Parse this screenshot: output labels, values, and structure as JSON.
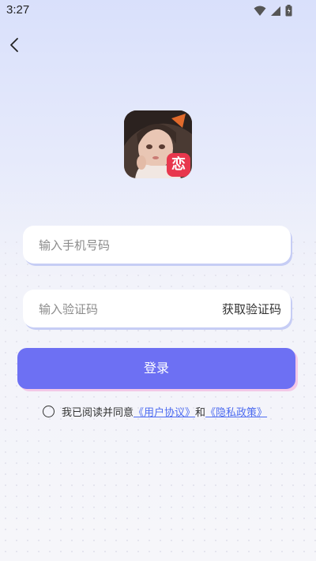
{
  "status_bar": {
    "time": "3:27",
    "icons": [
      "wifi-icon",
      "signal-icon",
      "battery-icon"
    ]
  },
  "nav": {
    "back_icon": "chevron-left-icon"
  },
  "app": {
    "badge_text": "恋"
  },
  "form": {
    "phone_placeholder": "输入手机号码",
    "code_placeholder": "输入验证码",
    "get_code_label": "获取验证码",
    "login_label": "登录"
  },
  "agreement": {
    "prefix": "我已阅读并同意",
    "user_agreement": "《用户协议》",
    "and": "和",
    "privacy_policy": "《隐私政策》"
  },
  "colors": {
    "primary": "#6d70f3",
    "link": "#4d6bf0",
    "badge": "#e8374d"
  }
}
